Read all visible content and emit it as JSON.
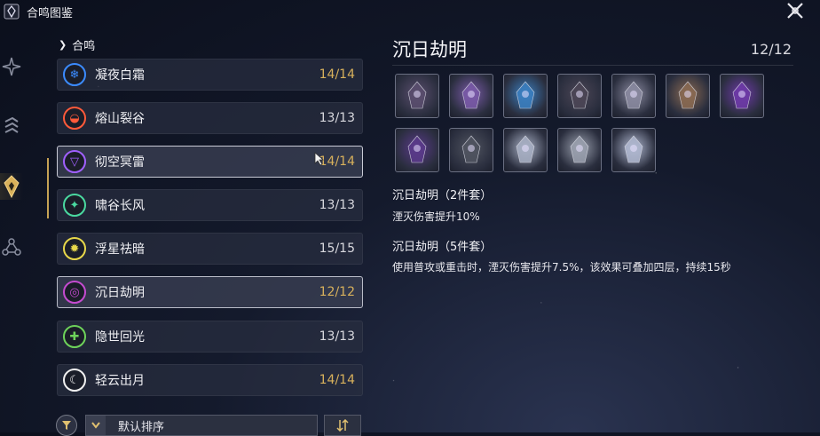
{
  "window": {
    "title": "合鸣图鉴"
  },
  "list": {
    "header": "合鸣",
    "items": [
      {
        "name": "凝夜白霜",
        "count": "14/14",
        "icon": "frost-snowflake-icon",
        "color": "#3b8bff",
        "count_color": "gold"
      },
      {
        "name": "熔山裂谷",
        "count": "13/13",
        "icon": "fusion-flame-icon",
        "color": "#ff5a3a",
        "count_color": "white"
      },
      {
        "name": "彻空冥雷",
        "count": "14/14",
        "icon": "electro-bolt-icon",
        "color": "#a060ff",
        "count_color": "gold"
      },
      {
        "name": "啸谷长风",
        "count": "13/13",
        "icon": "aero-wind-icon",
        "color": "#4ad9a0",
        "count_color": "white"
      },
      {
        "name": "浮星祛暗",
        "count": "15/15",
        "icon": "spectro-star-icon",
        "color": "#e8d84a",
        "count_color": "white"
      },
      {
        "name": "沉日劫明",
        "count": "12/12",
        "icon": "havoc-swirl-icon",
        "color": "#c54bd0",
        "count_color": "gold"
      },
      {
        "name": "隐世回光",
        "count": "13/13",
        "icon": "healing-cross-icon",
        "color": "#6ed35a",
        "count_color": "white"
      },
      {
        "name": "轻云出月",
        "count": "14/14",
        "icon": "moon-cloud-icon",
        "color": "#f0f0f0",
        "count_color": "gold"
      }
    ]
  },
  "sort": {
    "selected": "默认排序"
  },
  "detail": {
    "title": "沉日劫明",
    "count": "12/12",
    "sets": [
      {
        "name": "沉日劫明（2件套）",
        "desc": "湮灭伤害提升10%"
      },
      {
        "name": "沉日劫明（5件套）",
        "desc": "使用普攻或重击时，湮灭伤害提升7.5%，该效果可叠加四层，持续15秒"
      }
    ],
    "echoes": [
      {
        "icon": "echo-dark-warrior-icon",
        "tone": "#5a4e6e"
      },
      {
        "icon": "echo-purple-spirit-icon",
        "tone": "#7a5aa8"
      },
      {
        "icon": "echo-crystal-beast-icon",
        "tone": "#3b7fc0"
      },
      {
        "icon": "echo-shadow-gear-icon",
        "tone": "#4c4656"
      },
      {
        "icon": "echo-white-knight-icon",
        "tone": "#8a8aa0"
      },
      {
        "icon": "echo-brown-mask-icon",
        "tone": "#8a6a52"
      },
      {
        "icon": "echo-violet-orb-icon",
        "tone": "#6e3aa8"
      },
      {
        "icon": "echo-void-flower-icon",
        "tone": "#5a3a8a"
      },
      {
        "icon": "echo-grey-wolf-icon",
        "tone": "#505460"
      },
      {
        "icon": "echo-ice-dragon-icon",
        "tone": "#a8b0c4"
      },
      {
        "icon": "echo-snow-ball-icon",
        "tone": "#9aa0ae"
      },
      {
        "icon": "echo-frost-spike-icon",
        "tone": "#b0b8d0"
      }
    ]
  }
}
